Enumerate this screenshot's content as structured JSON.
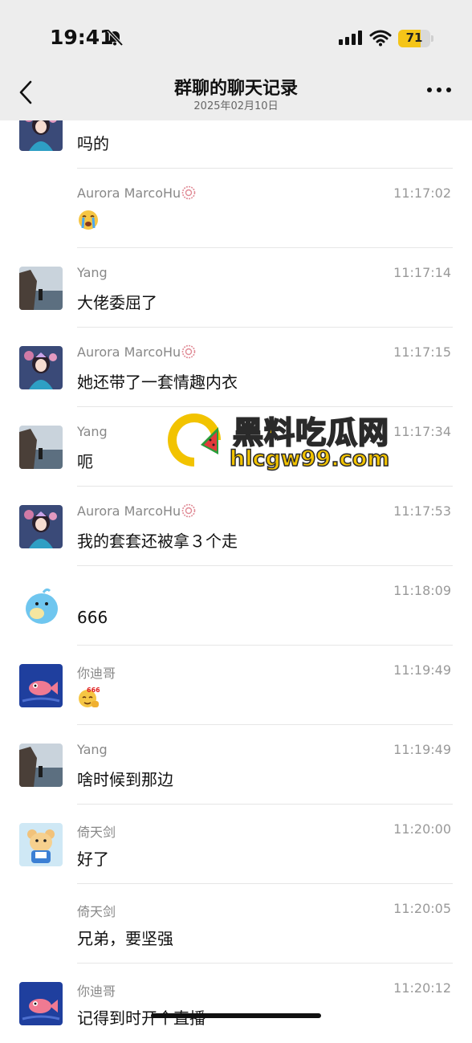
{
  "status_bar": {
    "time": "19:41",
    "battery": "71",
    "battery_fraction": 0.71
  },
  "header": {
    "title": "群聊的聊天记录",
    "date": "2025年02月10日"
  },
  "watermark": {
    "title": "黑料吃瓜网",
    "url": "hlcgw99.com"
  },
  "messages": [
    {
      "name": "",
      "time": "",
      "text": "吗的"
    },
    {
      "name": "Aurora MarcoHu",
      "time": "11:17:02",
      "text": "",
      "emoji": "crying-face-emoji"
    },
    {
      "name": "Yang",
      "time": "11:17:14",
      "text": "大佬委屈了"
    },
    {
      "name": "Aurora MarcoHu",
      "time": "11:17:15",
      "text": "她还带了一套情趣内衣"
    },
    {
      "name": "Yang",
      "time": "11:17:34",
      "text": "呃"
    },
    {
      "name": "Aurora MarcoHu",
      "time": "11:17:53",
      "text": "我的套套还被拿３个走"
    },
    {
      "name": "",
      "time": "11:18:09",
      "text": "666"
    },
    {
      "name": "你迪哥",
      "time": "11:19:49",
      "text": "",
      "emoji": "666-emoji"
    },
    {
      "name": "Yang",
      "time": "11:19:49",
      "text": "啥时候到那边"
    },
    {
      "name": "倚天剑",
      "time": "11:20:00",
      "text": "好了"
    },
    {
      "name": "倚天剑",
      "time": "11:20:05",
      "text": "兄弟，要坚强"
    },
    {
      "name": "你迪哥",
      "time": "11:20:12",
      "text": "记得到时开个直播"
    }
  ]
}
